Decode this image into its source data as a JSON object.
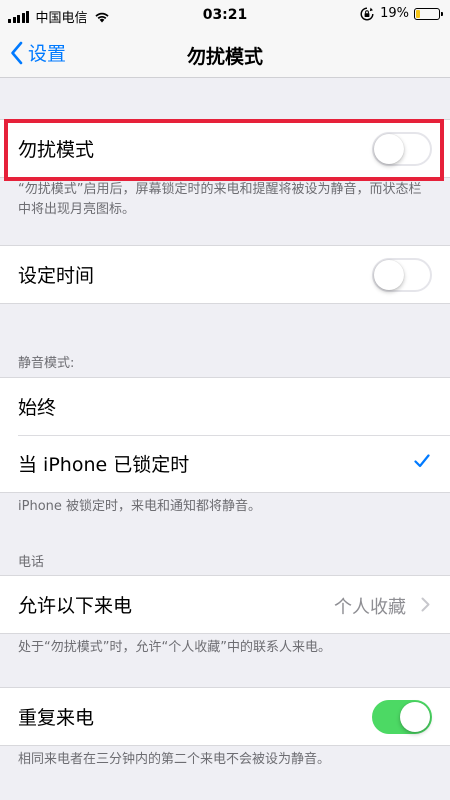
{
  "status_bar": {
    "carrier": "中国电信",
    "time": "03:21",
    "battery_percent": "19%",
    "battery_level": 0.19,
    "icons": [
      "signal-icon",
      "wifi-icon",
      "rotation-lock-icon",
      "battery-icon"
    ]
  },
  "nav": {
    "back_label": "设置",
    "title": "勿扰模式"
  },
  "dnd": {
    "label": "勿扰模式",
    "enabled": false,
    "footer": "“勿扰模式”启用后，屏幕锁定时的来电和提醒将被设为静音，而状态栏中将出现月亮图标。"
  },
  "scheduled": {
    "label": "设定时间",
    "enabled": false
  },
  "silence": {
    "header": "静音模式:",
    "options": [
      {
        "label": "始终",
        "selected": false
      },
      {
        "label": "当 iPhone 已锁定时",
        "selected": true
      }
    ],
    "footer": "iPhone 被锁定时，来电和通知都将静音。"
  },
  "phone": {
    "header": "电话",
    "allow_calls_label": "允许以下来电",
    "allow_calls_value": "个人收藏",
    "footer": "处于“勿扰模式”时，允许“个人收藏”中的联系人来电。"
  },
  "repeated": {
    "label": "重复来电",
    "enabled": true,
    "footer": "相同来电者在三分钟内的第二个来电不会被设为静音。"
  },
  "colors": {
    "accent": "#007aff",
    "toggle_on": "#4cd964",
    "highlight": "#e6213a",
    "background": "#efeff4"
  }
}
